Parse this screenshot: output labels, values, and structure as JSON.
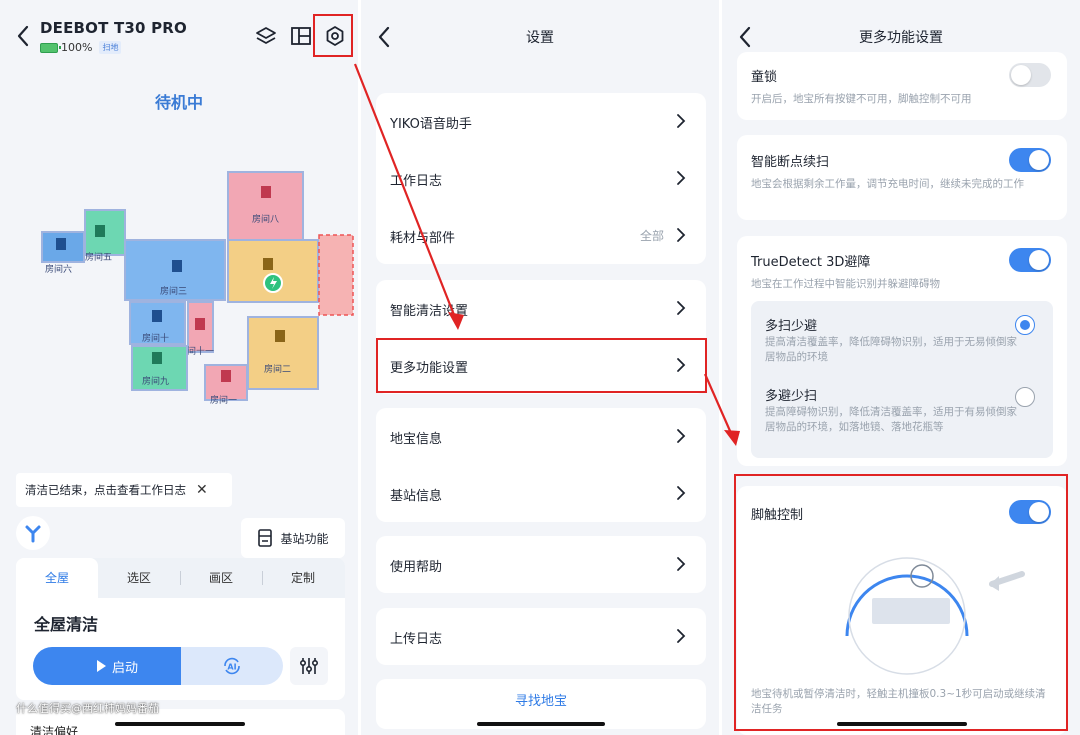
{
  "panel1": {
    "device_name": "DEEBOT T30 PRO",
    "battery": "100%",
    "mode_tag": "扫地",
    "status": "待机中",
    "rooms": [
      "房间八",
      "房间五",
      "房间六",
      "房间三",
      "房间十",
      "房间十一",
      "房间九",
      "房间二",
      "房间一"
    ],
    "notice": "清洁已结束，点击查看工作日志",
    "notice_close": "✕",
    "station_label": "基站功能",
    "tabs": [
      "全屋",
      "选区",
      "画区",
      "定制"
    ],
    "card_title": "全屋清洁",
    "start_label": "启动",
    "ai_label": "AI",
    "bottom_card": "清洁偏好",
    "watermark": "什么值得买@西红柿妈妈番茄"
  },
  "panel2": {
    "title": "设置",
    "rows": [
      {
        "label": "YIKO语音助手"
      },
      {
        "label": "工作日志"
      },
      {
        "label": "耗材与部件",
        "value": "全部"
      },
      {
        "label": "智能清洁设置"
      },
      {
        "label": "更多功能设置"
      },
      {
        "label": "地宝信息"
      },
      {
        "label": "基站信息"
      },
      {
        "label": "使用帮助"
      },
      {
        "label": "上传日志"
      }
    ],
    "find_button": "寻找地宝"
  },
  "panel3": {
    "title": "更多功能设置",
    "child_lock": {
      "title": "童锁",
      "desc": "开启后，地宝所有按键不可用，脚触控制不可用",
      "enabled": false
    },
    "resume": {
      "title": "智能断点续扫",
      "desc": "地宝会根据剩余工作量，调节充电时间，继续未完成的工作",
      "enabled": true
    },
    "truedetect": {
      "title": "TrueDetect 3D避障",
      "desc": "地宝在工作过程中智能识别并躲避障碍物",
      "enabled": true,
      "options": [
        {
          "title": "多扫少避",
          "desc": "提高清洁覆盖率，降低障碍物识别，适用于无易倾倒家居物品的环境",
          "selected": true
        },
        {
          "title": "多避少扫",
          "desc": "提高障碍物识别，降低清洁覆盖率，适用于有易倾倒家居物品的环境，如落地镜、落地花瓶等",
          "selected": false
        }
      ]
    },
    "foot_control": {
      "title": "脚触控制",
      "desc": "地宝待机或暂停清洁时，轻触主机撞板0.3~1秒可启动或继续清洁任务",
      "enabled": true
    }
  },
  "colors": {
    "accent": "#3d86ef",
    "highlight": "#e02424",
    "status_text": "#3a7bd5"
  }
}
